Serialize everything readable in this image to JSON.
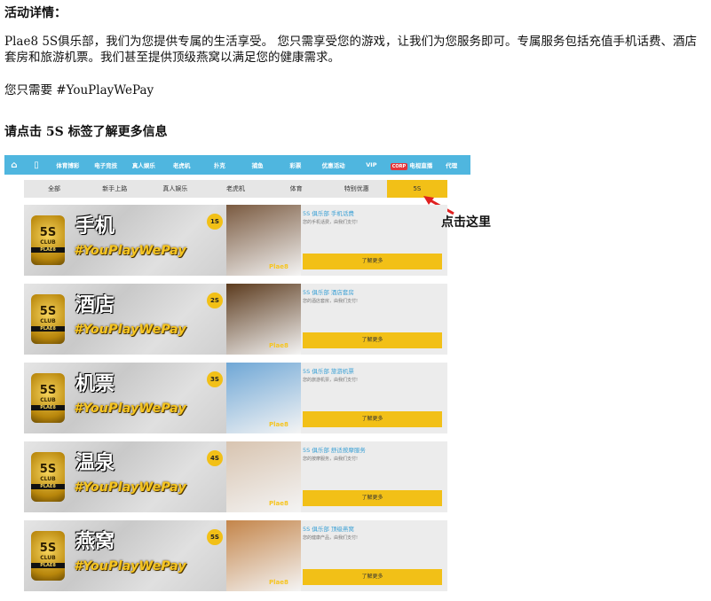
{
  "heading": "活动详情：",
  "paragraph": "Plae8 5S俱乐部，我们为您提供专属的生活享受。 您只需享受您的游戏，让我们为您服务即可。专属服务包括充值手机话费、酒店套房和旅游机票。我们甚至提供顶级燕窝以满足您的健康需求。",
  "tagline": "您只需要 #YouPlayWePay",
  "instruction": "请点击 5S 标签了解更多信息",
  "callout": "点击这里",
  "nav": {
    "items": [
      "体育博彩",
      "电子竞技",
      "真人娱乐",
      "老虎机",
      "扑克",
      "捕鱼",
      "彩票",
      "优惠活动",
      "VIP",
      "电视直播",
      "代理"
    ],
    "badge": "CORP"
  },
  "subtabs": [
    "全部",
    "新手上路",
    "真人娱乐",
    "老虎机",
    "体育",
    "特别优惠",
    "5S"
  ],
  "active_tab": "5S",
  "banners": [
    {
      "title": "手机",
      "level": "1S",
      "tag": "#YouPlayWePay",
      "right_title": "5S 俱乐部  手机话费",
      "right_sub": "您的手机话费，由我们支付!",
      "button": "了解更多",
      "pic_color": "#7a5a40"
    },
    {
      "title": "酒店",
      "level": "2S",
      "tag": "#YouPlayWePay",
      "right_title": "5S 俱乐部  酒店套房",
      "right_sub": "您的酒店套房，由我们支付!",
      "button": "了解更多",
      "pic_color": "#5c3b1e"
    },
    {
      "title": "机票",
      "level": "3S",
      "tag": "#YouPlayWePay",
      "right_title": "5S 俱乐部  旅游机票",
      "right_sub": "您的旅游机票，由我们支付!",
      "button": "了解更多",
      "pic_color": "#6fa7d6"
    },
    {
      "title": "温泉",
      "level": "4S",
      "tag": "#YouPlayWePay",
      "right_title": "5S 俱乐部  舒适按摩服务",
      "right_sub": "您的按摩服务，由我们支付!",
      "button": "了解更多",
      "pic_color": "#d8c4b0"
    },
    {
      "title": "燕窝",
      "level": "5S",
      "tag": "#YouPlayWePay",
      "right_title": "5S 俱乐部  顶级燕窝",
      "right_sub": "您的健康产品，由我们支付!",
      "button": "了解更多",
      "pic_color": "#c4854a"
    }
  ],
  "crest": {
    "top": "5S",
    "mid": "CLUB",
    "bottom": "PLAE8"
  },
  "brand": "Plae8"
}
